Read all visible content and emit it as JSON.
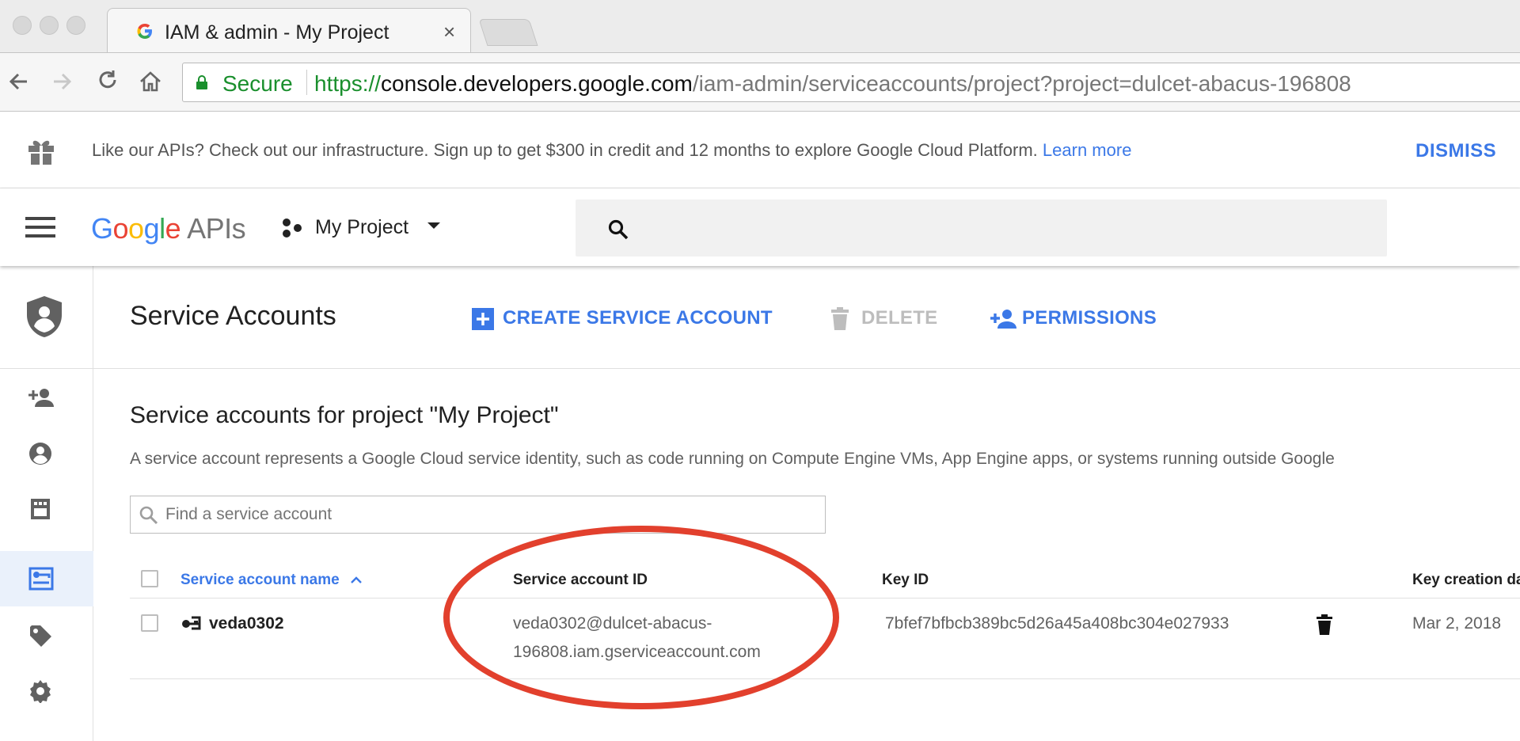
{
  "browser": {
    "tab_title": "IAM & admin - My Project",
    "tab_close": "×",
    "secure_label": "Secure",
    "url_scheme": "https://",
    "url_host": "console.developers.google.com",
    "url_path": "/iam-admin/serviceaccounts/project?project=dulcet-abacus-196808"
  },
  "promo": {
    "text": "Like our APIs? Check out our infrastructure. Sign up to get $300 in credit and 12 months to explore Google Cloud Platform.",
    "link": "Learn more",
    "dismiss": "DISMISS"
  },
  "appbar": {
    "logo_google": "Google",
    "logo_apis": "APIs",
    "project": "My Project"
  },
  "page": {
    "title": "Service Accounts",
    "actions": {
      "create": "CREATE SERVICE ACCOUNT",
      "delete": "DELETE",
      "permissions": "PERMISSIONS"
    },
    "section_title": "Service accounts for project \"My Project\"",
    "section_desc": "A service account represents a Google Cloud service identity, such as code running on Compute Engine VMs, App Engine apps, or systems running outside Google",
    "filter_placeholder": "Find a service account"
  },
  "table": {
    "columns": {
      "name": "Service account name",
      "id": "Service account ID",
      "key_id": "Key ID",
      "key_date": "Key creation date"
    },
    "sort_indicator": "^",
    "rows": [
      {
        "name": "veda0302",
        "id_line1": "veda0302@dulcet-abacus-",
        "id_line2": "196808.iam.gserviceaccount.com",
        "key_id": "7bfef7bfbcb389bc5d26a45a408bc304e027933",
        "key_date": "Mar 2, 2018"
      }
    ]
  },
  "colors": {
    "accent_blue": "#3b78e7",
    "secure_green": "#1a8f2d",
    "annotation_red": "#e2402d"
  },
  "icons": [
    "google-g-icon",
    "back-icon",
    "forward-icon",
    "reload-icon",
    "home-icon",
    "lock-icon",
    "gift-icon",
    "hamburger-icon",
    "project-icon",
    "search-icon",
    "shield-icon",
    "add-person-icon",
    "account-icon",
    "audit-icon",
    "service-account-icon",
    "label-icon",
    "settings-icon",
    "trash-icon",
    "sort-arrow-icon"
  ]
}
